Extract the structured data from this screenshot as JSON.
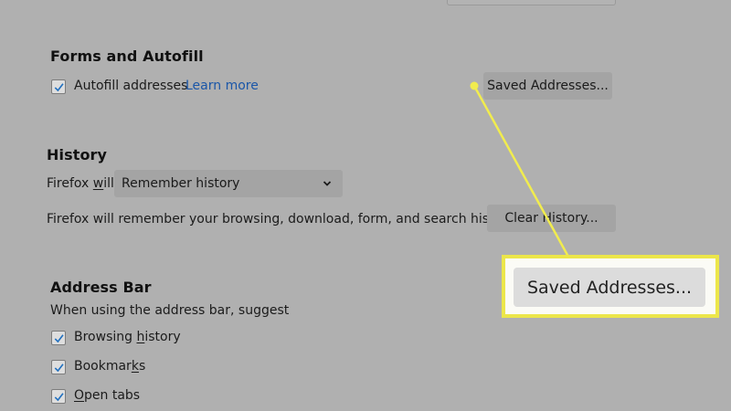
{
  "colors": {
    "page_background": "#b0b0b0",
    "link": "#1a56a8",
    "callout_border": "#ece64a",
    "pointer_line": "#f1ec4e"
  },
  "forms_autofill": {
    "heading": "Forms and Autofill",
    "autofill_checkbox": {
      "checked": true,
      "label": "Autofill addresses"
    },
    "learn_more": "Learn more",
    "saved_addresses_button": "Saved Addresses..."
  },
  "history": {
    "heading": "History",
    "firefox_will_label_pre": "Firefox ",
    "firefox_will_label_underlined": "w",
    "firefox_will_label_post": "ill",
    "select_value": "Remember history",
    "select_icon": "chevron-down-icon",
    "description": "Firefox will remember your browsing, download, form, and search history.",
    "clear_history_button": "Clear History..."
  },
  "address_bar": {
    "heading": "Address Bar",
    "description": "When using the address bar, suggest",
    "options": [
      {
        "pre": "Browsing ",
        "underlined": "h",
        "post": "istory",
        "checked": true
      },
      {
        "pre": "Bookmar",
        "underlined": "k",
        "post": "s",
        "checked": true
      },
      {
        "pre": "",
        "underlined": "O",
        "post": "pen tabs",
        "checked": true
      }
    ]
  },
  "callout": {
    "button_label": "Saved Addresses..."
  }
}
